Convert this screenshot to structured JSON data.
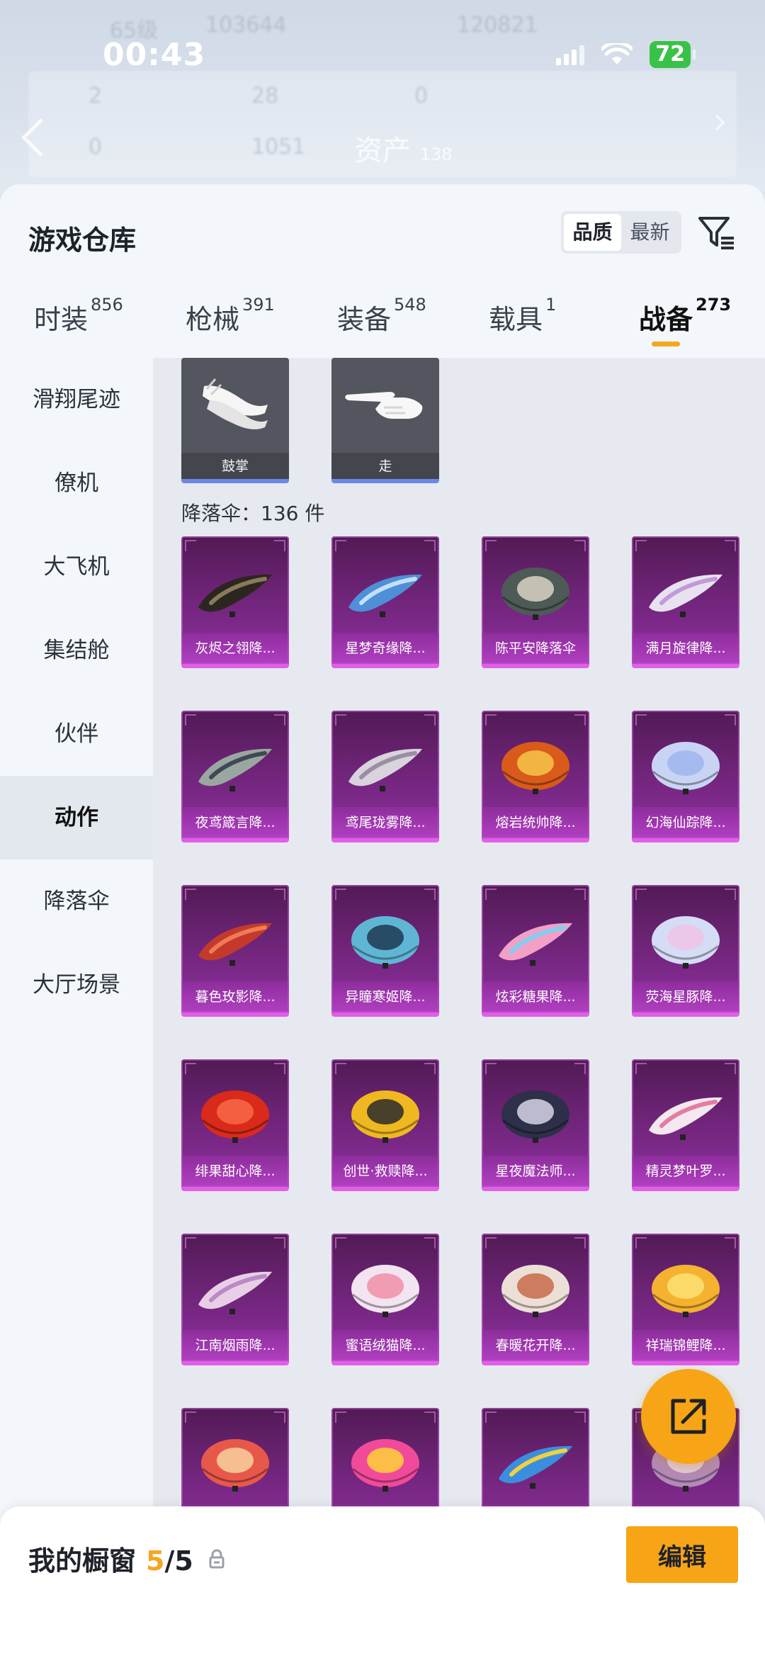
{
  "status_bar": {
    "time": "00:43",
    "battery": "72"
  },
  "background_header": {
    "level": "65级",
    "coins": "103644",
    "points": "120821",
    "assets_label": "资产",
    "assets_value": "138",
    "stats": [
      "2",
      "28",
      "0",
      "0",
      "1051"
    ]
  },
  "panel": {
    "title": "游戏仓库",
    "sort_options": [
      "品质",
      "最新"
    ],
    "active_sort": "品质"
  },
  "tabs": [
    {
      "label": "时装",
      "count": "856"
    },
    {
      "label": "枪械",
      "count": "391"
    },
    {
      "label": "装备",
      "count": "548"
    },
    {
      "label": "载具",
      "count": "1"
    },
    {
      "label": "战备",
      "count": "273"
    }
  ],
  "active_tab": "战备",
  "sidebar": [
    {
      "label": "滑翔尾迹"
    },
    {
      "label": "僚机"
    },
    {
      "label": "大飞机"
    },
    {
      "label": "集结舱"
    },
    {
      "label": "伙伴"
    },
    {
      "label": "动作"
    },
    {
      "label": "降落伞"
    },
    {
      "label": "大厅场景"
    }
  ],
  "active_sidebar": "动作",
  "action_items": [
    {
      "name": "鼓掌",
      "icon": "clap-hands-icon"
    },
    {
      "name": "走",
      "icon": "pointing-hand-icon"
    }
  ],
  "parachute_section": {
    "title": "降落伞：136 件"
  },
  "parachutes": [
    {
      "name": "灰烬之翎降...",
      "color": "#2c2621",
      "accent": "#8a7a5a",
      "shape": "wing"
    },
    {
      "name": "星梦奇缘降...",
      "color": "#4e8fd8",
      "accent": "#c3e0ff",
      "shape": "wing"
    },
    {
      "name": "陈平安降落伞",
      "color": "#4d5a56",
      "accent": "#d9d4c4",
      "shape": "dome"
    },
    {
      "name": "满月旋律降...",
      "color": "#e8e2f0",
      "accent": "#c09ad8",
      "shape": "wing"
    },
    {
      "name": "夜鸢箴言降...",
      "color": "#9aa7a0",
      "accent": "#3d4a55",
      "shape": "wing"
    },
    {
      "name": "鸢尾珑雾降...",
      "color": "#d8d3dc",
      "accent": "#9a8ea6",
      "shape": "wing"
    },
    {
      "name": "熔岩统帅降...",
      "color": "#d95a1a",
      "accent": "#f6c54a",
      "shape": "dome"
    },
    {
      "name": "幻海仙踪降...",
      "color": "#c9d4f5",
      "accent": "#9fb6ee",
      "shape": "dome"
    },
    {
      "name": "暮色玫影降...",
      "color": "#c43a2a",
      "accent": "#f07a56",
      "shape": "wing"
    },
    {
      "name": "异瞳寒姬降...",
      "color": "#5fb6d4",
      "accent": "#1f3a52",
      "shape": "dome"
    },
    {
      "name": "炫彩糖果降...",
      "color": "#f3a0c8",
      "accent": "#7fd0f0",
      "shape": "wing"
    },
    {
      "name": "荧海星豚降...",
      "color": "#d5dcf5",
      "accent": "#efc3e8",
      "shape": "dome"
    },
    {
      "name": "绯果甜心降...",
      "color": "#d92a1a",
      "accent": "#f8694a",
      "shape": "dome"
    },
    {
      "name": "创世·救赎降...",
      "color": "#f0b820",
      "accent": "#2a2a2a",
      "shape": "dome"
    },
    {
      "name": "星夜魔法师...",
      "color": "#2d3048",
      "accent": "#d7d3e8",
      "shape": "dome"
    },
    {
      "name": "精灵梦叶罗...",
      "color": "#f3e8f0",
      "accent": "#e57ba0",
      "shape": "wing"
    },
    {
      "name": "江南烟雨降...",
      "color": "#e8cfe6",
      "accent": "#b98ac8",
      "shape": "wing"
    },
    {
      "name": "蜜语绒猫降...",
      "color": "#f2e4f0",
      "accent": "#f28fa8",
      "shape": "dome"
    },
    {
      "name": "春暖花开降...",
      "color": "#ece0d6",
      "accent": "#c86a4a",
      "shape": "dome"
    },
    {
      "name": "祥瑞锦鲤降...",
      "color": "#f5b230",
      "accent": "#fbe074",
      "shape": "dome"
    },
    {
      "name": "",
      "color": "#e8584a",
      "accent": "#f8d0a0",
      "shape": "dome"
    },
    {
      "name": "",
      "color": "#f24a9a",
      "accent": "#ffd23a",
      "shape": "dome"
    },
    {
      "name": "",
      "color": "#3a8ee0",
      "accent": "#f0d040",
      "shape": "wing"
    },
    {
      "name": "",
      "color": "#b38ab8",
      "accent": "#e8d8e8",
      "shape": "dome"
    }
  ],
  "showcase": {
    "label": "我的橱窗",
    "count": "5",
    "total": "/5"
  },
  "buttons": {
    "edit": "编辑"
  }
}
